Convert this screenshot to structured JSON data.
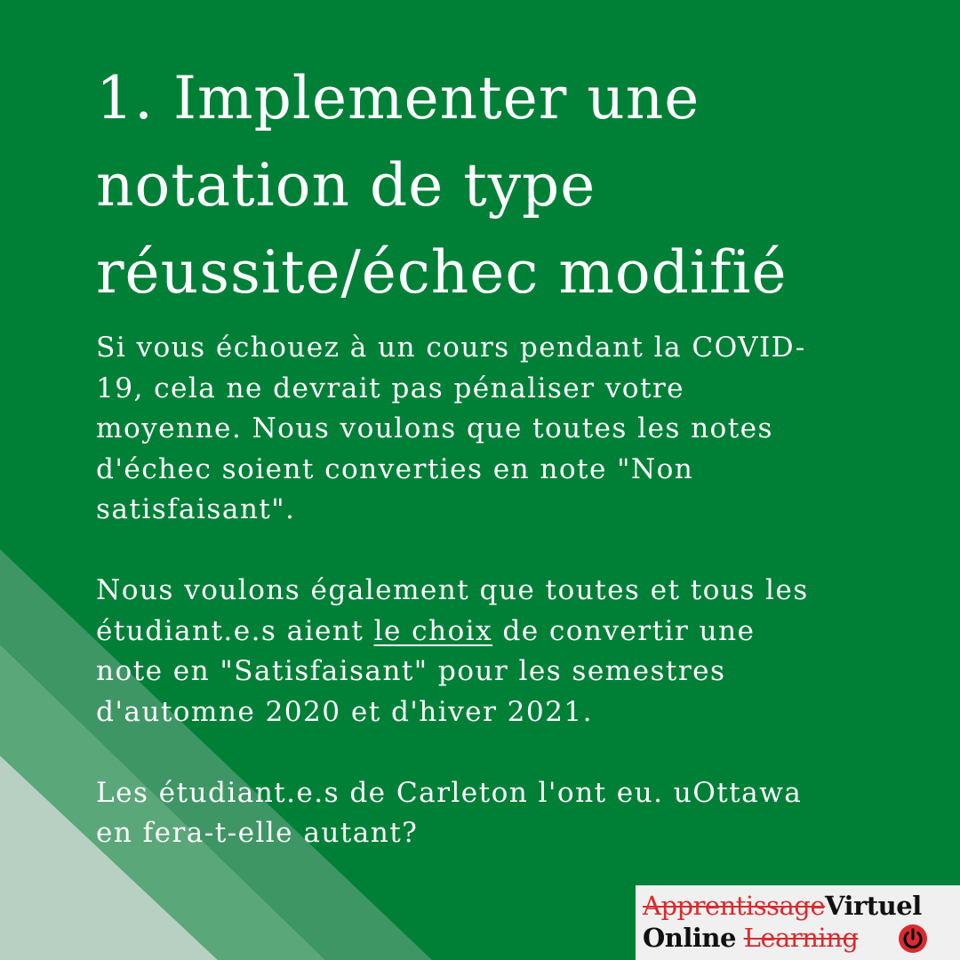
{
  "colors": {
    "background": "#008037",
    "stripe_light": "#b8d0c1",
    "stripe_mid": "#5aa77a",
    "stripe_dark": "#3e9665",
    "logo_red": "#d92b2f",
    "logo_dark": "#111111",
    "text": "#ffffff"
  },
  "title": {
    "line1": "1. Implementer une",
    "line2": "notation de type",
    "line3": "réussite/échec modifié"
  },
  "body": {
    "p1": {
      "line1": "Si vous échouez à un cours pendant la COVID-",
      "line2": "19, cela ne devrait pas pénaliser votre",
      "line3": "moyenne. Nous voulons que toutes les notes",
      "line4": "d'échec soient converties en note \"Non",
      "line5": "satisfaisant\"."
    },
    "p2": {
      "line1": "Nous voulons également que toutes et tous les",
      "line2_before": "étudiant.e.s aient ",
      "line2_underlined": "le choix",
      "line2_after": " de convertir une",
      "line3": "note en \"Satisfaisant\" pour les semestres",
      "line4": "d'automne 2020 et d'hiver 2021."
    },
    "p3": {
      "line1": "Les étudiant.e.s de Carleton l'ont eu. uOttawa",
      "line2": "en fera-t-elle autant?"
    }
  },
  "logo": {
    "top_strikethrough": "Apprentissage",
    "top_main": "Virtuel",
    "bottom_main": "Online",
    "bottom_strikethrough": "Learning",
    "power_icon": "power-icon"
  }
}
